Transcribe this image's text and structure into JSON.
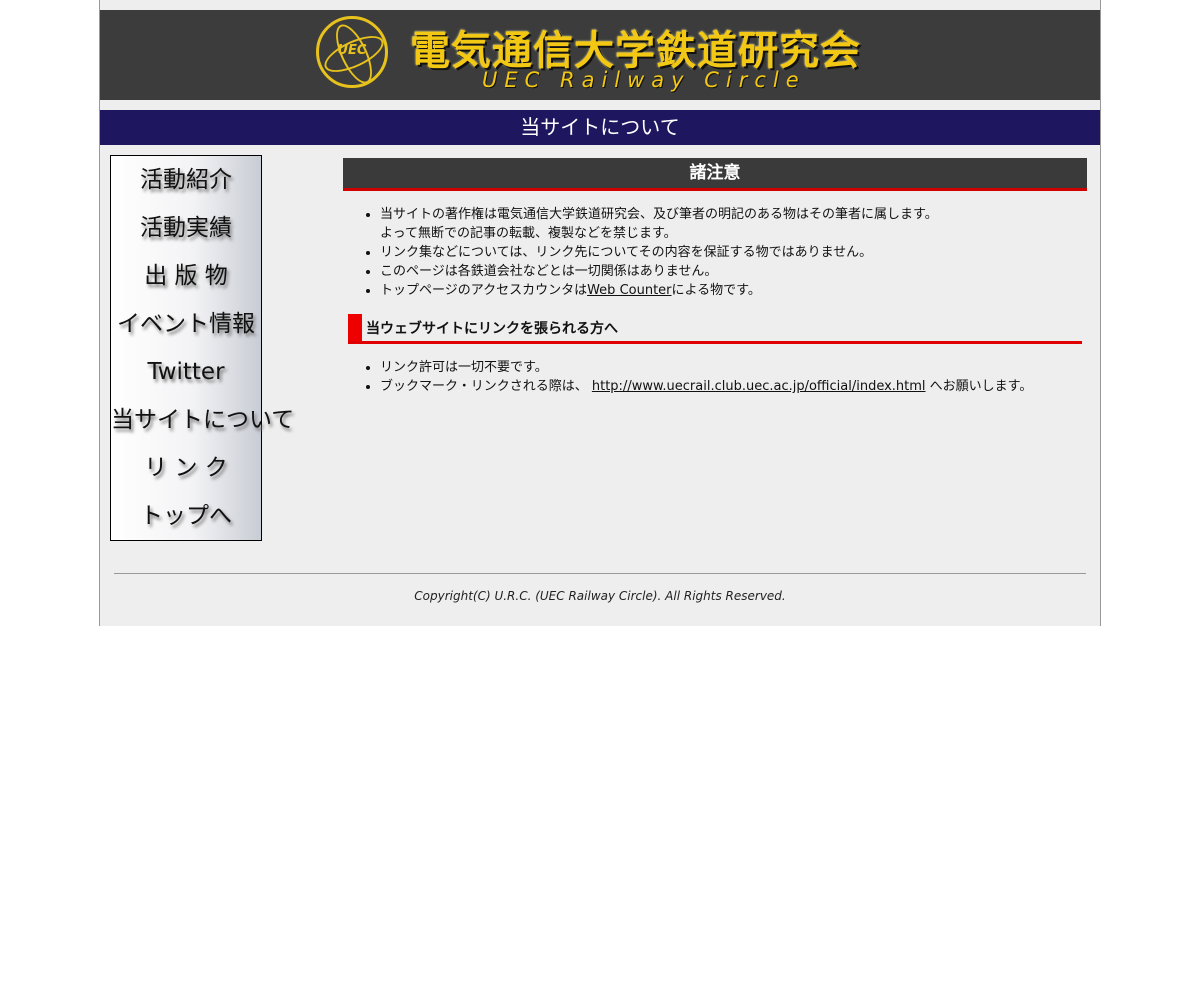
{
  "banner": {
    "logo_abbr": "UEC",
    "title": "電気通信大学鉄道研究会",
    "subtitle": "UEC Railway Circle",
    "accent_color": "#f2c814",
    "background": "#3c3c3c"
  },
  "page_title": "当サイトについて",
  "sidebar": {
    "items": [
      {
        "label": "活動紹介"
      },
      {
        "label": "活動実績"
      },
      {
        "label": "出 版 物"
      },
      {
        "label": "イベント情報"
      },
      {
        "label": "Twitter"
      },
      {
        "label": "当サイトについて"
      },
      {
        "label": "リ ン ク"
      },
      {
        "label": "トップへ"
      }
    ]
  },
  "notes": {
    "heading": "諸注意",
    "items": [
      {
        "line1": "当サイトの著作権は電気通信大学鉄道研究会、及び筆者の明記のある物はその筆者に属します。",
        "line2": "よって無断での記事の転載、複製などを禁じます。"
      },
      {
        "text": "リンク集などについては、リンク先についてその内容を保証する物ではありません。"
      },
      {
        "text": "このページは各鉄道会社などとは一切関係はありません。"
      },
      {
        "before": "トップページのアクセスカウンタは",
        "link": "Web Counter",
        "after": "による物です。"
      }
    ]
  },
  "linking": {
    "heading": "当ウェブサイトにリンクを張られる方へ",
    "items": [
      {
        "text": "リンク許可は一切不要です。"
      },
      {
        "before": "ブックマーク・リンクされる際は、 ",
        "link": "http://www.uecrail.club.uec.ac.jp/official/index.html",
        "after": " へお願いします。"
      }
    ]
  },
  "footer": {
    "copyright": "Copyright(C) U.R.C. (UEC Railway Circle). All Rights Reserved."
  },
  "colors": {
    "title_bar": "#1f1660",
    "section_head": "#3a3a3a",
    "accent_red": "#ee0000",
    "page_bg": "#eeeeee"
  }
}
